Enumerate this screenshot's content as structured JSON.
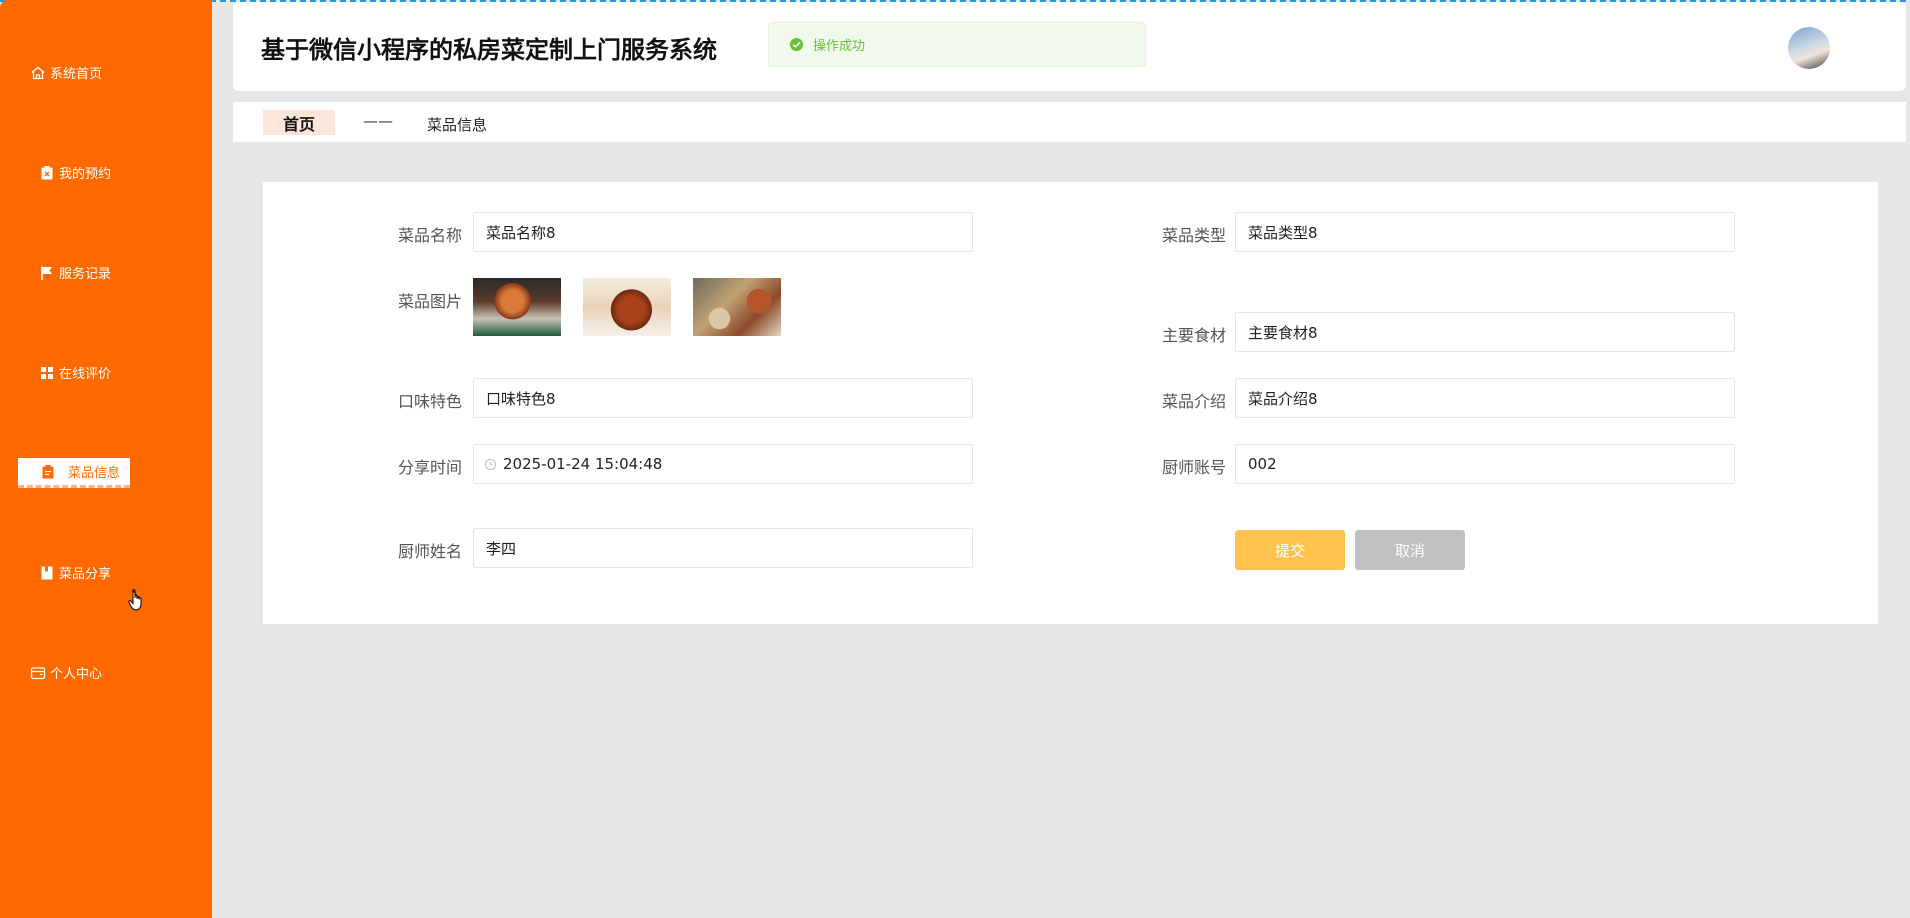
{
  "app": {
    "title": "基于微信小程序的私房菜定制上门服务系统"
  },
  "toast": {
    "message": "操作成功"
  },
  "sidebar": {
    "items": [
      {
        "label": "系统首页",
        "icon": "home-icon"
      },
      {
        "label": "我的预约",
        "icon": "clipboard-x-icon"
      },
      {
        "label": "服务记录",
        "icon": "flag-icon"
      },
      {
        "label": "在线评价",
        "icon": "grid-icon"
      },
      {
        "label": "菜品信息",
        "icon": "clipboard-icon",
        "active": true
      },
      {
        "label": "菜品分享",
        "icon": "book-icon"
      },
      {
        "label": "个人中心",
        "icon": "wallet-icon"
      }
    ]
  },
  "breadcrumb": {
    "home": "首页",
    "separator": "——",
    "current": "菜品信息"
  },
  "form": {
    "dish_name": {
      "label": "菜品名称",
      "value": "菜品名称8"
    },
    "dish_type": {
      "label": "菜品类型",
      "value": "菜品类型8"
    },
    "dish_image": {
      "label": "菜品图片"
    },
    "main_ingredient": {
      "label": "主要食材",
      "value": "主要食材8"
    },
    "flavor": {
      "label": "口味特色",
      "value": "口味特色8"
    },
    "intro": {
      "label": "菜品介绍",
      "value": "菜品介绍8"
    },
    "share_time": {
      "label": "分享时间",
      "value": "2025-01-24 15:04:48"
    },
    "chef_account": {
      "label": "厨师账号",
      "value": "002"
    },
    "chef_name": {
      "label": "厨师姓名",
      "value": "李四"
    },
    "submit_label": "提交",
    "cancel_label": "取消"
  },
  "colors": {
    "sidebar": "#ff6a00",
    "submit": "#ffc34d",
    "cancel": "#c0c0c0",
    "toast_bg": "#f0f9eb",
    "toast_text": "#67c23a"
  }
}
